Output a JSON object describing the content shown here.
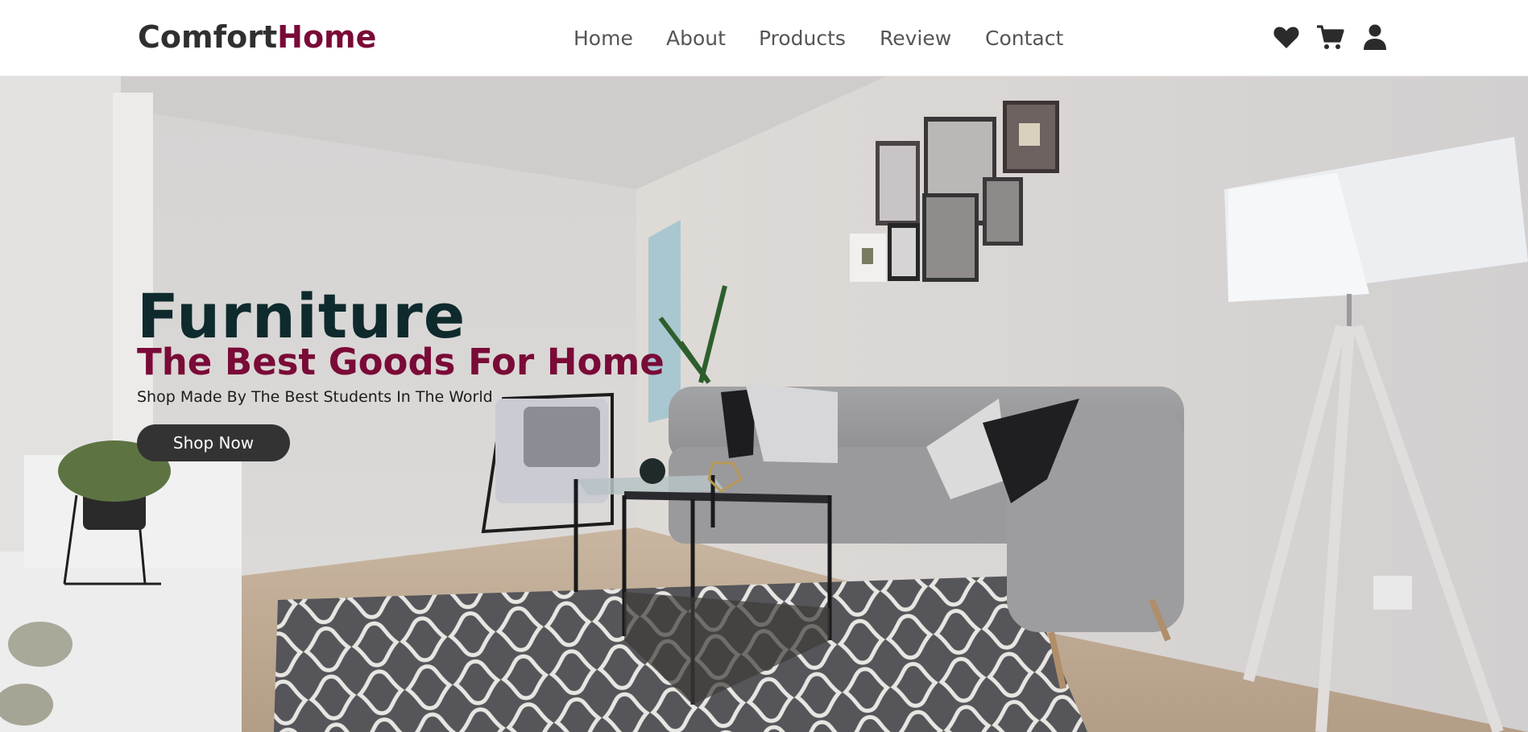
{
  "brand": {
    "part1": "Comfort",
    "part2": "Home",
    "accent_color": "#7a0a37"
  },
  "nav": {
    "items": [
      {
        "label": "Home"
      },
      {
        "label": "About"
      },
      {
        "label": "Products"
      },
      {
        "label": "Review"
      },
      {
        "label": "Contact"
      }
    ]
  },
  "header_icons": [
    "heart-icon",
    "shopping-cart-icon",
    "user-icon"
  ],
  "hero": {
    "title": "Furniture",
    "subtitle": "The Best Goods For Home",
    "tagline": "Shop Made By The Best Students In The World",
    "cta_label": "Shop Now",
    "title_color": "#0e2a2c",
    "button_color": "#333333"
  }
}
